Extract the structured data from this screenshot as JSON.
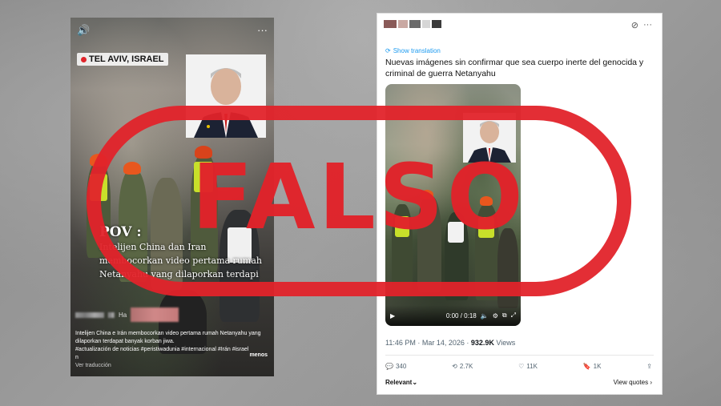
{
  "left_post": {
    "location": "TEL AVIV, ISRAEL",
    "sound_icon": "speaker-icon",
    "more_icon": "more-dots-icon",
    "overlay_title": "POV :",
    "overlay_lines": [
      "Intelijen China dan Iran",
      "membocorkan video pertama rumah",
      "Netanyahu yang dilaporkan terdapi"
    ],
    "user_suffix": "Ha",
    "caption_lines": [
      "Intelijen China e Irán membocorkan video pertama rumah Netanyahu yang",
      "dilaporkan terdapat banyak korban jiwa.",
      "#actualización de noticias #peristiwadunia #internacional #Irán #israel",
      "n"
    ],
    "more_label": "menos",
    "translate_label": "Ver traducción"
  },
  "tweet": {
    "show_translation": "Show translation",
    "text": "Nuevas imágenes sin confirmar que sea cuerpo inerte del genocida y criminal de guerra Netanyahu",
    "video_time": "0:00 / 0:18",
    "timestamp": "11:46 PM · Mar 14, 2026 · ",
    "views_count": "932.9K",
    "views_label": " Views",
    "replies": "340",
    "reposts": "2.7K",
    "likes": "11K",
    "bookmarks": "1K",
    "relevant_label": "Relevant",
    "view_quotes_label": "View quotes"
  },
  "stamp": {
    "word": "FALSO",
    "color": "#e1232a"
  }
}
